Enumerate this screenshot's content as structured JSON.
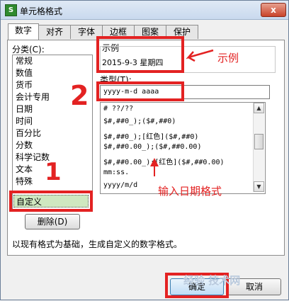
{
  "window": {
    "title": "单元格格式",
    "close_symbol": "x"
  },
  "tabs": [
    {
      "label": "数字",
      "active": true
    },
    {
      "label": "对齐"
    },
    {
      "label": "字体"
    },
    {
      "label": "边框"
    },
    {
      "label": "图案"
    },
    {
      "label": "保护"
    }
  ],
  "category": {
    "label": "分类(C):",
    "items": [
      "常规",
      "数值",
      "货币",
      "会计专用",
      "日期",
      "时间",
      "百分比",
      "分数",
      "科学记数",
      "文本",
      "特殊",
      "自定义"
    ],
    "selected": "自定义",
    "delete_button": "删除(D)"
  },
  "sample": {
    "label": "示例",
    "value": "2015-9-3 星期四"
  },
  "type": {
    "label": "类型(T):",
    "input_value": "yyyy-m-d aaaa",
    "list": [
      "# ??/??",
      "$#,##0_);($#,##0)",
      "$#,##0_);[红色]($#,##0)",
      "$#,##0.00_);($#,##0.00)",
      "$#,##0.00_);[红色]($#,##0.00)",
      "mm:ss.",
      "yyyy/m/d"
    ]
  },
  "description": "以现有格式为基础，生成自定义的数字格式。",
  "buttons": {
    "ok": "确定",
    "cancel": "取消"
  },
  "annotations": {
    "sample_note": "示例",
    "format_note": "输入日期格式",
    "num1": "1",
    "num2": "2",
    "watermark": "经验 技术网"
  },
  "colors": {
    "annotation_red": "#e32222",
    "selection_green": "#cfe8c0"
  }
}
